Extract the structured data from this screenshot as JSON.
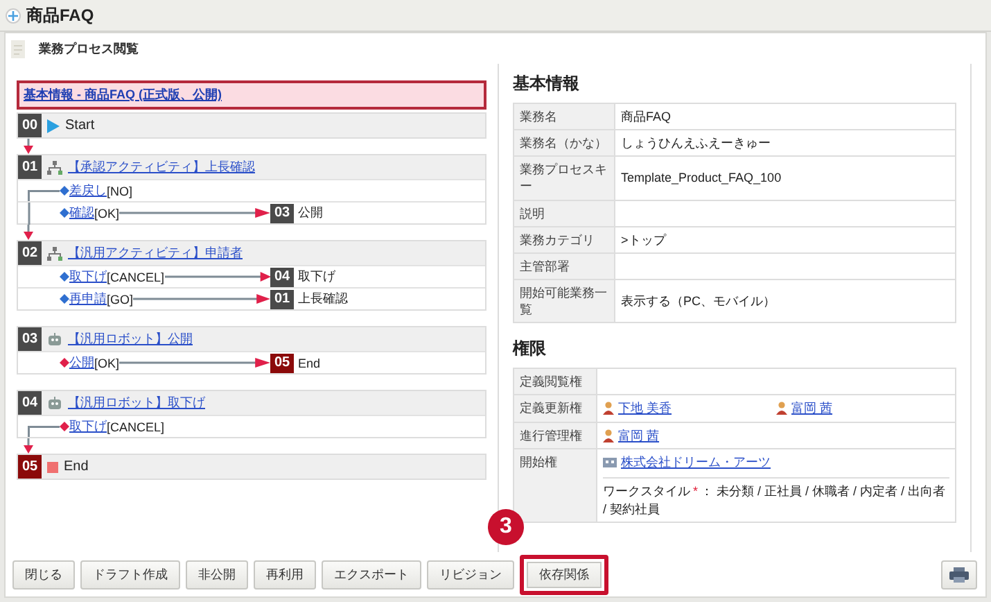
{
  "window": {
    "title": "商品FAQ"
  },
  "subheader": "業務プロセス閲覧",
  "flow": {
    "basic_link": "基本情報 - 商品FAQ (正式版、公開)",
    "steps": [
      {
        "number": "00",
        "kind": "start",
        "label": "Start",
        "color": "#4a4a4a"
      },
      {
        "number": "01",
        "kind": "activity",
        "label": "【承認アクティビティ】上長確認",
        "color": "#4a4a4a",
        "arrow_in": true,
        "transitions": [
          {
            "link": "差戻し",
            "code": "[NO]",
            "color": "#2f6fd0",
            "loop": true
          },
          {
            "link": "確認",
            "code": "[OK]",
            "color": "#2f6fd0",
            "loop": false,
            "target": {
              "number": "03",
              "label": "公開",
              "color": "#4a4a4a"
            }
          }
        ]
      },
      {
        "number": "02",
        "kind": "activity",
        "label": "【汎用アクティビティ】申請者",
        "color": "#4a4a4a",
        "arrow_in": true,
        "transitions": [
          {
            "link": "取下げ",
            "code": "[CANCEL]",
            "color": "#2f6fd0",
            "loop": false,
            "target": {
              "number": "04",
              "label": "取下げ",
              "color": "#4a4a4a"
            }
          },
          {
            "link": "再申請",
            "code": "[GO]",
            "color": "#2f6fd0",
            "loop": false,
            "target": {
              "number": "01",
              "label": "上長確認",
              "color": "#4a4a4a"
            }
          }
        ]
      },
      {
        "number": "03",
        "kind": "robot",
        "label": "【汎用ロボット】公開",
        "color": "#4a4a4a",
        "arrow_in": false,
        "transitions": [
          {
            "link": "公開",
            "code": "[OK]",
            "color": "#e0204a",
            "loop": false,
            "target": {
              "number": "05",
              "label": "End",
              "color": "#8b0a0a"
            }
          }
        ]
      },
      {
        "number": "04",
        "kind": "robot",
        "label": "【汎用ロボット】取下げ",
        "color": "#4a4a4a",
        "arrow_in": false,
        "transitions": [
          {
            "link": "取下げ",
            "code": "[CANCEL]",
            "color": "#e0204a",
            "loop": true
          }
        ]
      },
      {
        "number": "05",
        "kind": "end",
        "label": "End",
        "color": "#8b0a0a",
        "arrow_in": true
      }
    ]
  },
  "basic_info": {
    "heading": "基本情報",
    "rows": [
      {
        "label": "業務名",
        "value": "商品FAQ"
      },
      {
        "label": "業務名（かな）",
        "value": "しょうひんえふえーきゅー"
      },
      {
        "label": "業務プロセスキー",
        "value": "Template_Product_FAQ_100"
      },
      {
        "label": "説明"
      },
      {
        "label": "業務カテゴリ",
        "value": ">トップ"
      },
      {
        "label": "主管部署"
      },
      {
        "label": "開始可能業務一覧",
        "value": "表示する（PC、モバイル）"
      }
    ]
  },
  "permissions": {
    "heading": "権限",
    "rows": [
      {
        "label": "定義閲覧権",
        "kind": "empty"
      },
      {
        "label": "定義更新権",
        "kind": "users",
        "users": [
          "下地 美香",
          "富岡 茜"
        ]
      },
      {
        "label": "進行管理権",
        "kind": "users",
        "users": [
          "富岡 茜"
        ]
      },
      {
        "label": "開始権",
        "kind": "org",
        "org": "株式会社ドリーム・アーツ",
        "work_style": {
          "label": "ワークスタイル",
          "mark": "*",
          "separator": "：",
          "value": "未分類 / 正社員 / 休職者 / 内定者 / 出向者 / 契約社員"
        }
      }
    ]
  },
  "buttons": [
    {
      "label": "閉じる",
      "highlighted": false
    },
    {
      "label": "ドラフト作成",
      "highlighted": false
    },
    {
      "label": "非公開",
      "highlighted": false
    },
    {
      "label": "再利用",
      "highlighted": false
    },
    {
      "label": "エクスポート",
      "highlighted": false
    },
    {
      "label": "リビジョン",
      "highlighted": false
    },
    {
      "label": "依存関係",
      "highlighted": true
    }
  ],
  "annotation": {
    "number": "3"
  }
}
